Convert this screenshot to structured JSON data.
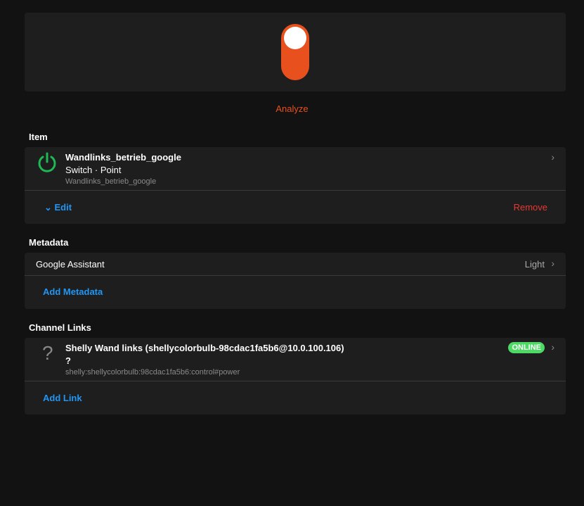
{
  "toggle": {
    "state": "on",
    "color": "#e8501e"
  },
  "analyze_label": "Analyze",
  "item": {
    "header": "Item",
    "name": "Wandlinks_betrieb_google",
    "type": "Switch · Point",
    "id": "Wandlinks_betrieb_google",
    "edit_label": "Edit",
    "remove_label": "Remove"
  },
  "metadata": {
    "header": "Metadata",
    "entries": [
      {
        "label": "Google Assistant",
        "value": "Light"
      }
    ],
    "add_label": "Add Metadata"
  },
  "channel_links": {
    "header": "Channel Links",
    "links": [
      {
        "icon": "?",
        "title": "Shelly Wand links (shellycolorbulb-98cdac1fa5b6@10.0.100.106)",
        "state": "?",
        "uid": "shelly:shellycolorbulb:98cdac1fa5b6:control#power",
        "status": "ONLINE"
      }
    ],
    "add_label": "Add Link"
  }
}
